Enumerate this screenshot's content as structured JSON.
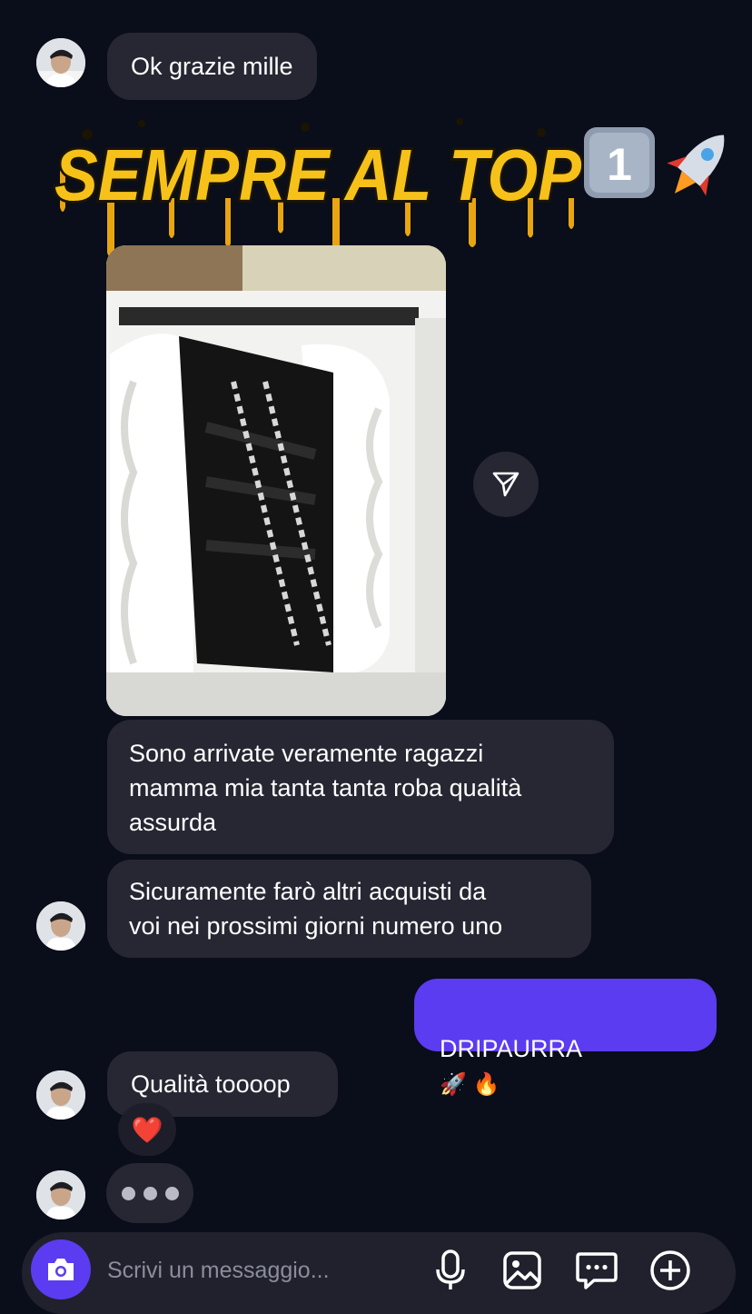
{
  "thread": {
    "messages": [
      {
        "text": "Ok grazie mille",
        "side": "received"
      },
      {
        "text": "Sono arrivate veramente ragazzi\nmamma mia tanta tanta roba qualità\nassurda",
        "side": "received"
      },
      {
        "text": "Sicuramente farò altri acquisti da\nvoi nei prossimi giorni numero uno",
        "side": "received"
      },
      {
        "text": "DRIPAURRA",
        "side": "sent"
      },
      {
        "text": "Qualità toooop",
        "side": "received"
      }
    ],
    "banner": {
      "text": "SEMPRE AL TOP",
      "badge": "1"
    },
    "reaction_emoji": "❤️",
    "sent_emojis": "🚀 🔥"
  },
  "composer": {
    "placeholder": "Scrivi un messaggio..."
  },
  "icons": {
    "share": "paper-plane-icon",
    "camera": "camera-icon",
    "mic": "microphone-icon",
    "gallery": "image-icon",
    "sticker": "chat-bubble-icon",
    "more": "plus-circle-icon"
  },
  "colors": {
    "background": "#0a0d1a",
    "bubble_received": "#262733",
    "bubble_sent": "#5b3cf0",
    "banner_text": "#f6c21a"
  }
}
